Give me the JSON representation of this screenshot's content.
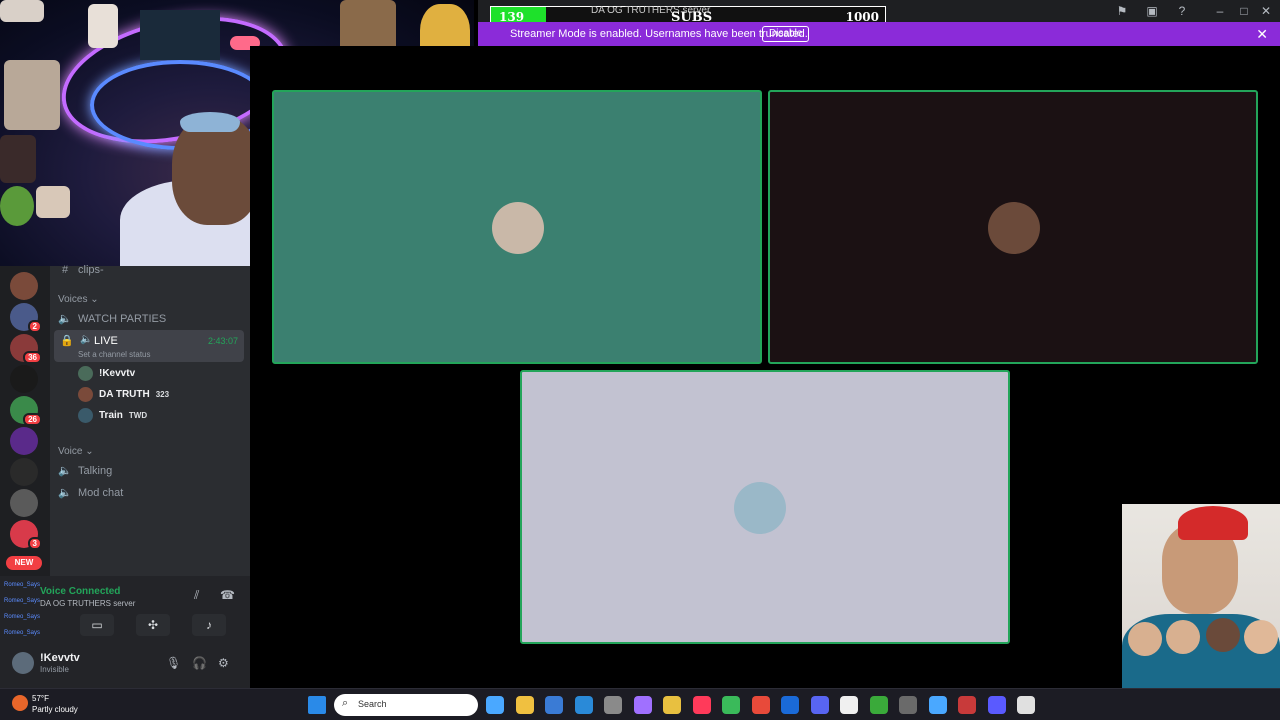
{
  "sub_goal": {
    "current": "139",
    "label": "SUBS",
    "target": "1000",
    "progress": 0.139,
    "server_ghost": "DA OG TRUTHERS server"
  },
  "streamer_banner": {
    "text": "Streamer Mode is enabled. Usernames have been truncated.",
    "disable_label": "Disable",
    "close_icon": "close-icon"
  },
  "titlebar": {
    "icons": [
      "flag-icon",
      "inbox-icon",
      "help-icon",
      "minimize-icon",
      "maximize-icon",
      "close-icon"
    ]
  },
  "sidebar": {
    "clips_label": "clips-",
    "voices_category": "Voices",
    "watch_parties": "WATCH PARTIES",
    "live_channel": {
      "name": "LIVE",
      "status": "Set a channel status",
      "duration": "2:43:07"
    },
    "members": [
      {
        "name": "!Kevvtv",
        "tag": "",
        "color": "#4a6b5a"
      },
      {
        "name": "DA TRUTH",
        "tag": "323",
        "color": "#7a4a3a"
      },
      {
        "name": "Train",
        "tag": "TWD",
        "color": "#3a5a6a"
      }
    ],
    "voice_category": "Voice",
    "voice_channels": [
      "Talking",
      "Mod chat"
    ]
  },
  "rail": {
    "servers": [
      {
        "badge": "",
        "color": "#7a4a3a"
      },
      {
        "badge": "2",
        "color": "#4a5a8a"
      },
      {
        "badge": "36",
        "color": "#8a3a3a"
      },
      {
        "badge": "",
        "color": "#1a1a1a"
      },
      {
        "badge": "26",
        "color": "#3a8a4a"
      },
      {
        "badge": "",
        "color": "#5a2a8a"
      },
      {
        "badge": "",
        "color": "#2a2a2a"
      },
      {
        "badge": "",
        "color": "#5a5a5a"
      },
      {
        "badge": "3",
        "color": "#d83a4a"
      }
    ],
    "new_label": "NEW"
  },
  "voice_panel": {
    "connected": "Voice Connected",
    "server": "DA OG TRUTHERS server",
    "chat_name": "Romeo_Says"
  },
  "user_panel": {
    "name": "!Kevvtv",
    "status": "Invisible"
  },
  "stage": {
    "tiles": [
      {
        "bg": "#3b8070",
        "avatar": "#c9b8a8"
      },
      {
        "bg": "#1b1113",
        "avatar": "#6b4a3a"
      },
      {
        "bg": "#c2c2d1",
        "avatar": "#9ab8c8"
      }
    ]
  },
  "taskbar": {
    "temp": "57°F",
    "condition": "Partly cloudy",
    "search_placeholder": "Search",
    "apps": [
      "#4aa8ff",
      "#f0c040",
      "#3a7bd5",
      "#2a8ad8",
      "#8a8a8a",
      "#a070ff",
      "#e8c040",
      "#ff3a5a",
      "#3aba5a",
      "#e84a3a",
      "#1a6ad8",
      "#5865f2",
      "#f0f0f0",
      "#3aaa3a",
      "#6a6a6a",
      "#4aa8ff",
      "#c83a3a",
      "#5a5aff",
      "#e0e0e0"
    ]
  }
}
